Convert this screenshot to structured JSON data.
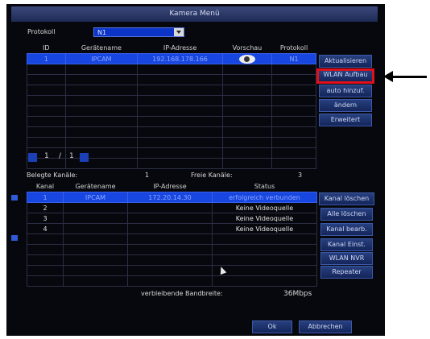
{
  "window": {
    "title": "Kamera Menü"
  },
  "protocol": {
    "label": "Protokoll",
    "value": "N1"
  },
  "cam_table": {
    "headers": [
      "ID",
      "Gerätename",
      "IP-Adresse",
      "Vorschau",
      "Protokoll"
    ],
    "rows": [
      {
        "id": "1",
        "name": "IPCAM",
        "ip": "192.168.178.166",
        "proto": "N1"
      }
    ]
  },
  "right_buttons_top": {
    "refresh": "Aktualisieren",
    "wlan_setup": "WLAN Aufbau",
    "auto_add": "auto hinzuf.",
    "change": "ändern",
    "advanced": "Erweitert"
  },
  "pager": {
    "current": "1",
    "separator": "/",
    "total": "1"
  },
  "channels": {
    "used_label": "Belegte Kanäle:",
    "used_value": "1",
    "free_label": "Freie Kanäle:",
    "free_value": "3"
  },
  "ch_table": {
    "headers": [
      "Kanal",
      "Gerätename",
      "IP-Adresse",
      "Status"
    ],
    "rows": [
      {
        "ch": "1",
        "name": "IPCAM",
        "ip": "172.20.14.30",
        "status": "erfolgreich verbunden"
      },
      {
        "ch": "2",
        "name": "",
        "ip": "",
        "status": "Keine Videoquelle"
      },
      {
        "ch": "3",
        "name": "",
        "ip": "",
        "status": "Keine Videoquelle"
      },
      {
        "ch": "4",
        "name": "",
        "ip": "",
        "status": "Keine Videoquelle"
      }
    ]
  },
  "right_buttons_bottom": {
    "delete_channel": "Kanal löschen",
    "delete_all": "Alle löschen",
    "edit_channel": "Kanal bearb.",
    "channel_settings": "Kanal Einst.",
    "wlan_nvr": "WLAN NVR",
    "repeater": "Repeater"
  },
  "bandwidth": {
    "label": "verbleibende Bandbreite:",
    "value": "36Mbps"
  },
  "footer": {
    "ok": "Ok",
    "cancel": "Abbrechen"
  },
  "colors": {
    "highlight": "#e1101a",
    "selection": "#1746e0"
  }
}
